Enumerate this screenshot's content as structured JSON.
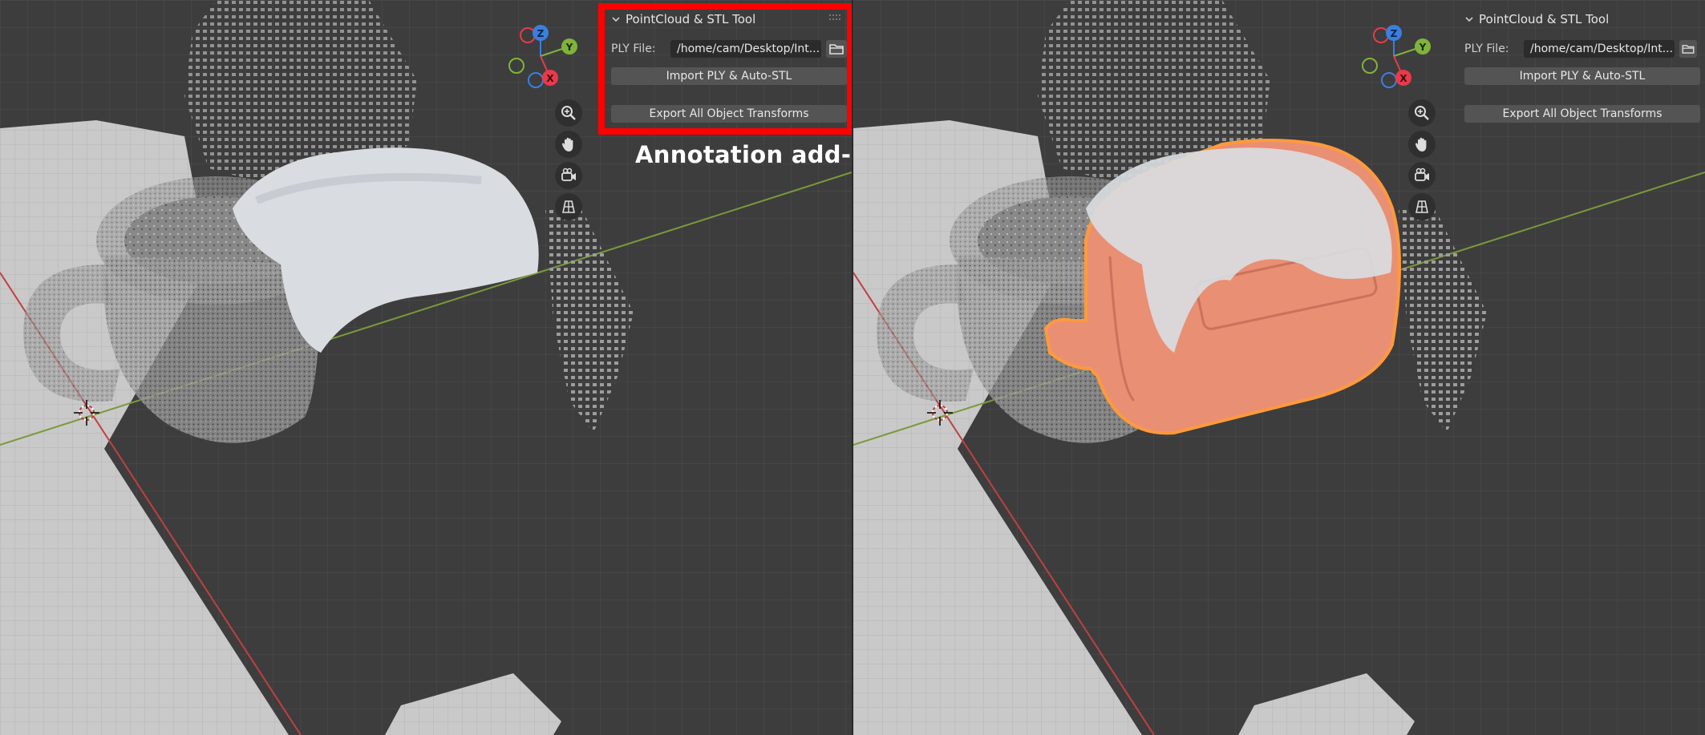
{
  "colors": {
    "viewport_bg": "#3d3d3d",
    "panel_button": "#545454",
    "field_bg": "#2b2b2b",
    "highlight": "#ff0000",
    "selection_outline": "#ff9a3c",
    "mesh_fill": "#e98f74",
    "axis_x": "#c04040",
    "axis_y": "#7a9a3a",
    "gizmo_x": "#e83a4a",
    "gizmo_y": "#7fb43a",
    "gizmo_z": "#3a7fe0"
  },
  "annotation": {
    "label": "Annotation add-on"
  },
  "viewports": [
    {
      "id": "left",
      "panel": {
        "title": "PointCloud & STL Tool",
        "ply_label": "PLY File:",
        "ply_path": "/home/cam/Desktop/Int...",
        "import_button": "Import PLY & Auto-STL",
        "export_button": "Export All Object Transforms"
      },
      "gizmo": {
        "x": "X",
        "y": "Y",
        "z": "Z"
      },
      "nav_icons": [
        "zoom-icon",
        "hand-pan-icon",
        "camera-icon",
        "grid-view-icon"
      ]
    },
    {
      "id": "right",
      "panel": {
        "title": "PointCloud & STL Tool",
        "ply_label": "PLY File:",
        "ply_path": "/home/cam/Desktop/Int...",
        "import_button": "Import PLY & Auto-STL",
        "export_button": "Export All Object Transforms"
      },
      "gizmo": {
        "x": "X",
        "y": "Y",
        "z": "Z"
      },
      "nav_icons": [
        "zoom-icon",
        "hand-pan-icon",
        "camera-icon",
        "grid-view-icon"
      ]
    }
  ]
}
